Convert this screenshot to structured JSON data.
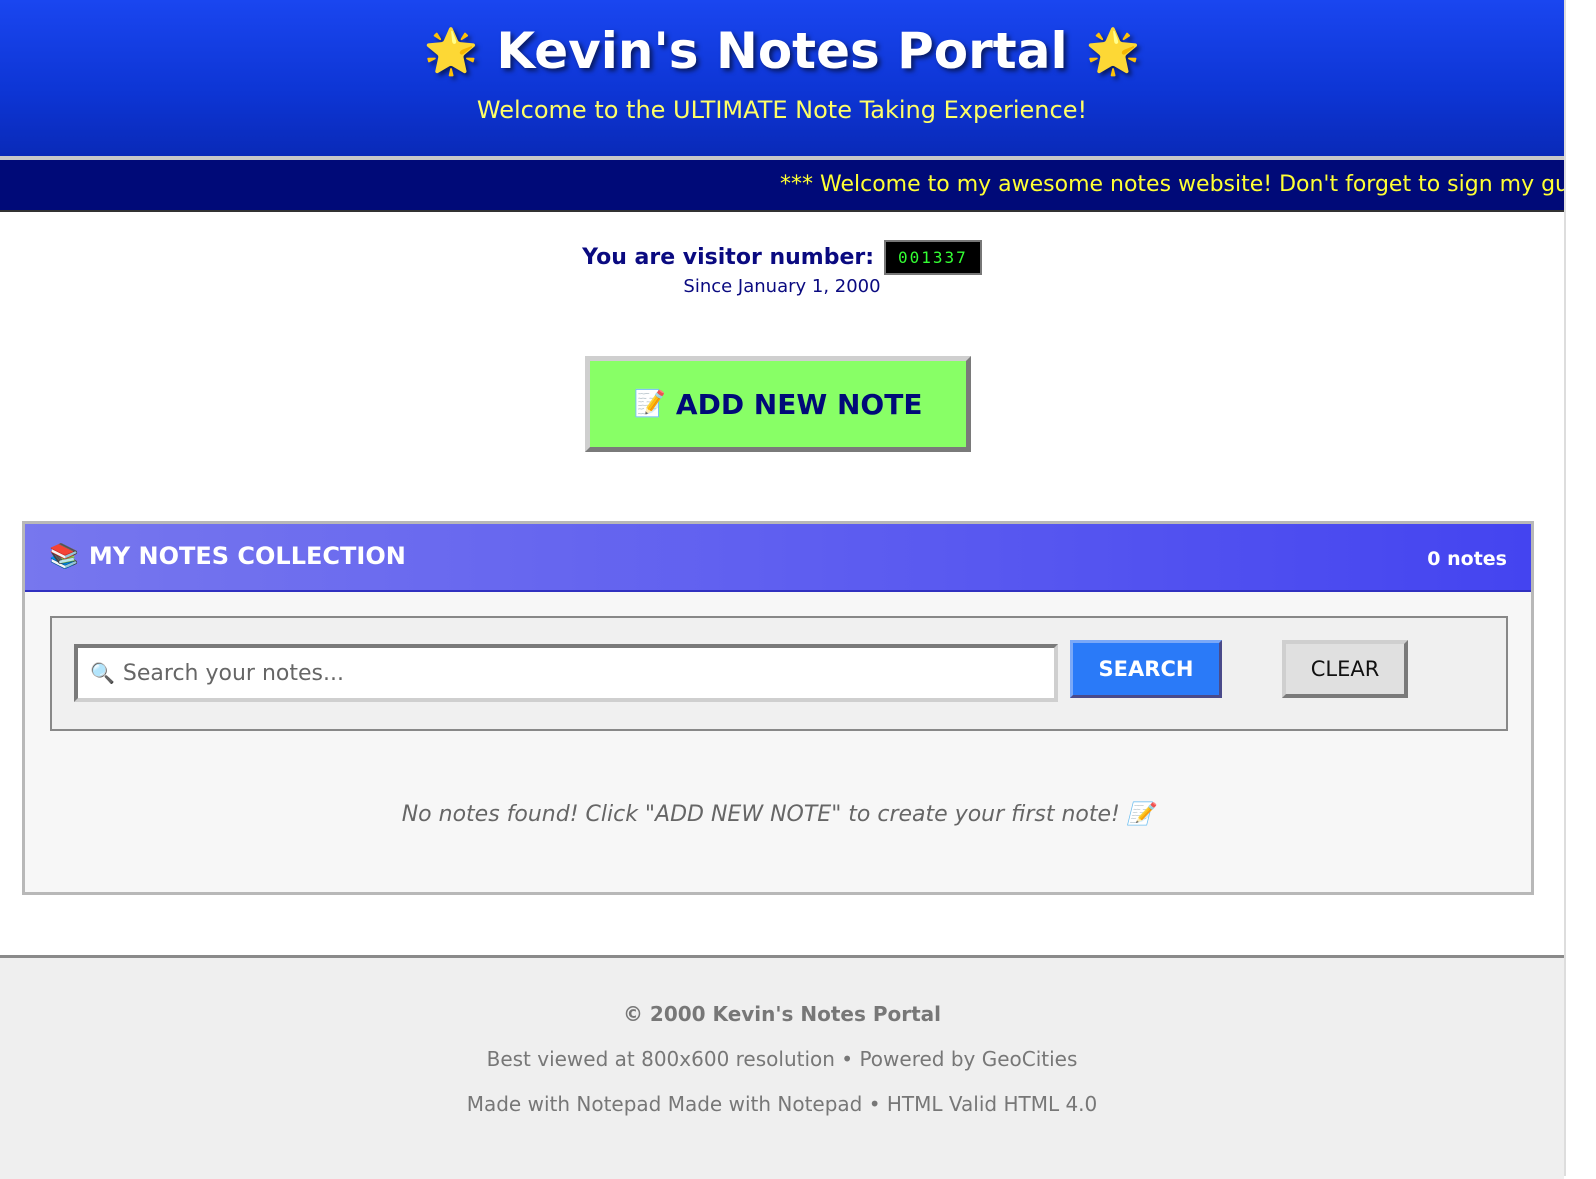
{
  "header": {
    "title": "Kevin's Notes Portal",
    "subtitle": "Welcome to the ULTIMATE Note Taking Experience!",
    "star_icon": "🌟"
  },
  "marquee": {
    "text": "*** Welcome to my awesome notes website! Don't forget to sign my guestbook! ***"
  },
  "visitor": {
    "label": "You are visitor number:",
    "count": "001337",
    "since": "Since January 1, 2000"
  },
  "add_button": {
    "icon": "📝",
    "label": "ADD NEW NOTE"
  },
  "notes_panel": {
    "icon": "📚",
    "title": "MY NOTES COLLECTION",
    "count_label": "0 notes",
    "search_placeholder": "Search your notes...",
    "search_icon": "🔍",
    "search_button": "SEARCH",
    "clear_button": "CLEAR",
    "empty_message": "No notes found! Click \"ADD NEW NOTE\" to create your first note! 📝"
  },
  "footer": {
    "copyright": "© 2000 Kevin's Notes Portal",
    "line2": "Best viewed at 800x600 resolution • Powered by GeoCities",
    "line3": "Made with Notepad Made with Notepad • HTML Valid HTML 4.0"
  },
  "colors": {
    "header_blue": "#1a46f0",
    "marquee_bg": "#000a78",
    "marquee_text": "#ffff33",
    "add_button_bg": "#88ff66",
    "search_button_bg": "#2a7af8",
    "counter_text": "#33ff33"
  }
}
